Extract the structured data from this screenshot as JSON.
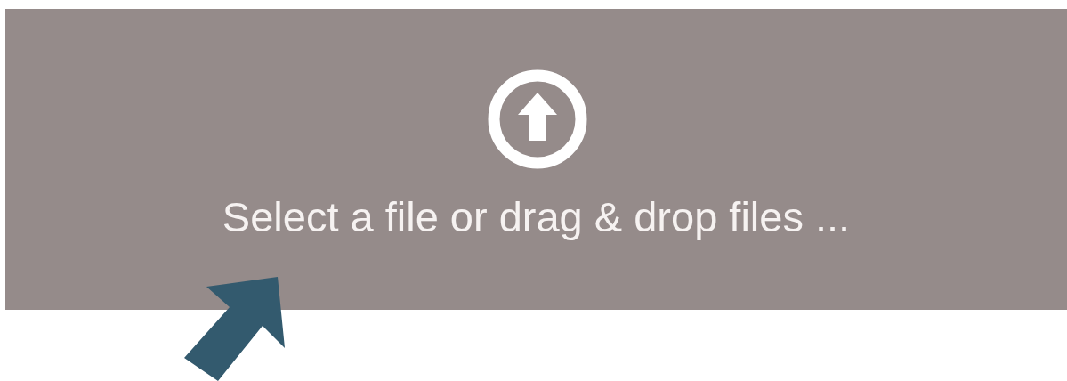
{
  "dropzone": {
    "label": "Select a file or drag & drop files ..."
  }
}
